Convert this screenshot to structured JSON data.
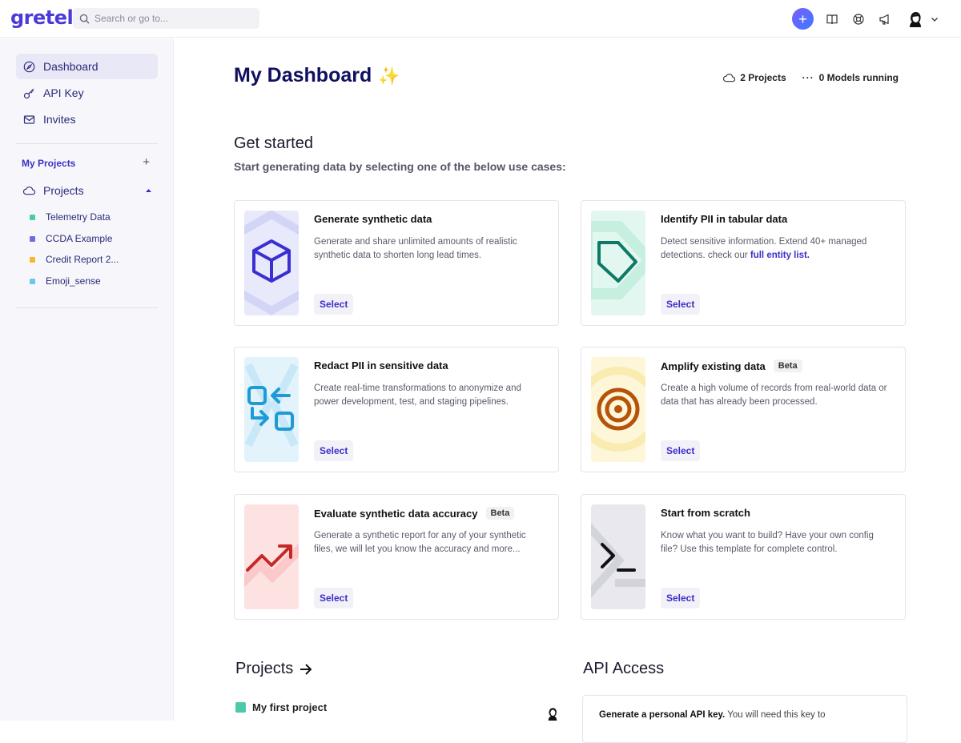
{
  "app": {
    "logo": "gretel"
  },
  "search": {
    "placeholder": "Search or go to..."
  },
  "topbar": {
    "icons": [
      "plus-icon",
      "book-icon",
      "support-icon",
      "megaphone-icon",
      "avatar",
      "chevron-down-icon"
    ]
  },
  "sidebar": {
    "items": [
      {
        "label": "Dashboard",
        "icon": "compass-icon",
        "active": true
      },
      {
        "label": "API Key",
        "icon": "key-icon"
      },
      {
        "label": "Invites",
        "icon": "mail-icon"
      }
    ],
    "my_projects_label": "My Projects",
    "projects_label": "Projects",
    "projects": [
      {
        "label": "Telemetry Data",
        "color": "#4ec9a8"
      },
      {
        "label": "CCDA Example",
        "color": "#6a6ee0"
      },
      {
        "label": "Credit Report 2...",
        "color": "#f5b82e"
      },
      {
        "label": "Emoji_sense",
        "color": "#6cc8e8"
      }
    ]
  },
  "header": {
    "title": "My Dashboard",
    "title_emoji": "✨",
    "projects_count": "2 Projects",
    "models_running": "0 Models running"
  },
  "get_started": {
    "title": "Get started",
    "subtitle": "Start generating data by selecting one of the below use cases:"
  },
  "cards": [
    {
      "title": "Generate synthetic data",
      "desc": "Generate and share unlimited amounts of realistic synthetic data to shorten long lead times.",
      "select": "Select",
      "icon": "cube-icon"
    },
    {
      "title": "Identify PII in tabular data",
      "desc": "Detect sensitive information. Extend 40+ managed detections. check our ",
      "link": "full entity list.",
      "select": "Select",
      "icon": "tag-icon"
    },
    {
      "title": "Redact PII in sensitive data",
      "desc": "Create real-time transformations to anonymize and power development, test, and staging pipelines.",
      "select": "Select",
      "icon": "transform-icon"
    },
    {
      "title": "Amplify existing data",
      "badge": "Beta",
      "desc": "Create a high volume of records from real-world data or data that has already been processed.",
      "select": "Select",
      "icon": "target-icon"
    },
    {
      "title": "Evaluate synthetic data accuracy",
      "badge": "Beta",
      "desc": "Generate a synthetic report for any of your synthetic files, we will let you know the accuracy and more...",
      "select": "Select",
      "icon": "trend-icon"
    },
    {
      "title": "Start from scratch",
      "desc": "Know what you want to build? Have your own config file? Use this template for complete control.",
      "select": "Select",
      "icon": "terminal-icon"
    }
  ],
  "projects_section": {
    "title": "Projects",
    "first_project": "My first project"
  },
  "api_section": {
    "title": "API Access",
    "text_bold": "Generate a personal API key.",
    "text": " You will need this key to"
  }
}
